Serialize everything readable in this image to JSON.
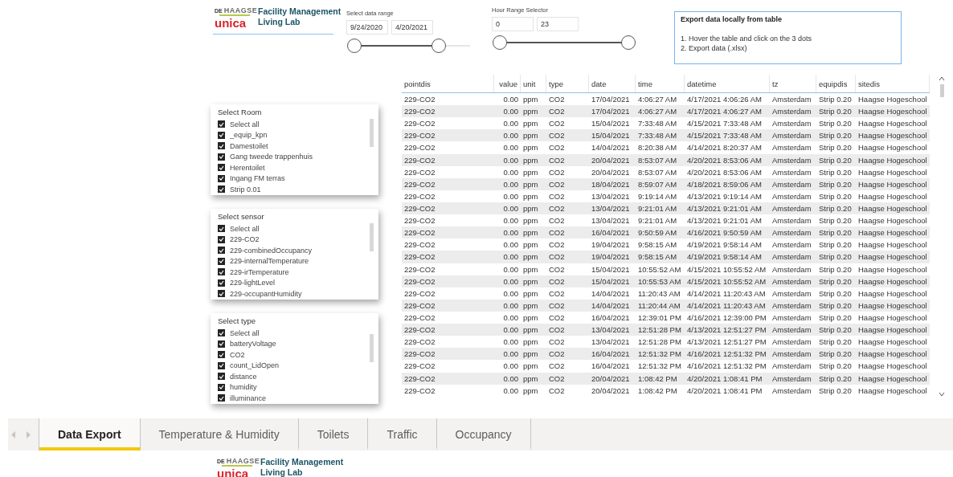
{
  "header": {
    "logo": {
      "prefix": "DE",
      "name": "HAAGSE",
      "brand": "unica"
    },
    "title_lines": [
      "Facility Management",
      "Living Lab"
    ]
  },
  "date_range": {
    "label": "Select data range",
    "start": "9/24/2020",
    "end": "4/20/2021",
    "thumbs": [
      {
        "level": 0
      },
      {
        "level": 0.73
      }
    ]
  },
  "hour_range": {
    "label": "Hour Range Selector",
    "start": "0",
    "end": "23",
    "thumbs": [
      {
        "level": 0
      },
      {
        "level": 1
      }
    ]
  },
  "export_note": {
    "title": "Export data locally from table",
    "steps": [
      "1. Hover the table and click on the 3 dots",
      "2. Export data (.xlsx)"
    ]
  },
  "slicers": [
    {
      "title": "Select Room",
      "items": [
        {
          "label": "Select all",
          "checked": true
        },
        {
          "label": "_equip_kpn",
          "checked": true
        },
        {
          "label": "Damestoilet",
          "checked": true
        },
        {
          "label": "Gang tweede trappenhuis",
          "checked": true
        },
        {
          "label": "Herentoilet",
          "checked": true
        },
        {
          "label": "Ingang FM terras",
          "checked": true
        },
        {
          "label": "Strip 0.01",
          "checked": true
        }
      ]
    },
    {
      "title": "Select sensor",
      "items": [
        {
          "label": "Select all",
          "checked": true
        },
        {
          "label": "229-CO2",
          "checked": true
        },
        {
          "label": "229-combinedOccupancy",
          "checked": true
        },
        {
          "label": "229-internalTemperature",
          "checked": true
        },
        {
          "label": "229-irTemperature",
          "checked": true
        },
        {
          "label": "229-lightLevel",
          "checked": true
        },
        {
          "label": "229-occupantHumidity",
          "checked": true
        }
      ]
    },
    {
      "title": "Select type",
      "items": [
        {
          "label": "Select all",
          "checked": true
        },
        {
          "label": "batteryVoltage",
          "checked": true
        },
        {
          "label": "CO2",
          "checked": true
        },
        {
          "label": "count_LidOpen",
          "checked": true
        },
        {
          "label": "distance",
          "checked": true
        },
        {
          "label": "humidity",
          "checked": true
        },
        {
          "label": "illuminance",
          "checked": true
        }
      ]
    }
  ],
  "table": {
    "columns": [
      {
        "label": "pointdis",
        "kind": "text"
      },
      {
        "label": "value",
        "kind": "number"
      },
      {
        "label": "unit",
        "kind": "text"
      },
      {
        "label": "type",
        "kind": "text"
      },
      {
        "label": "date",
        "kind": "text"
      },
      {
        "label": "time",
        "kind": "text"
      },
      {
        "label": "datetime",
        "kind": "text"
      },
      {
        "label": "tz",
        "kind": "text"
      },
      {
        "label": "equipdis",
        "kind": "text"
      },
      {
        "label": "sitedis",
        "kind": "text"
      }
    ],
    "rows": [
      [
        "229-CO2",
        "0.00",
        "ppm",
        "CO2",
        "17/04/2021",
        "4:06:27 AM",
        "4/17/2021 4:06:26 AM",
        "Amsterdam",
        "Strip 0.20",
        "Haagse Hogeschool"
      ],
      [
        "229-CO2",
        "0.00",
        "ppm",
        "CO2",
        "17/04/2021",
        "4:06:27 AM",
        "4/17/2021 4:06:27 AM",
        "Amsterdam",
        "Strip 0.20",
        "Haagse Hogeschool"
      ],
      [
        "229-CO2",
        "0.00",
        "ppm",
        "CO2",
        "15/04/2021",
        "7:33:48 AM",
        "4/15/2021 7:33:48 AM",
        "Amsterdam",
        "Strip 0.20",
        "Haagse Hogeschool"
      ],
      [
        "229-CO2",
        "0.00",
        "ppm",
        "CO2",
        "15/04/2021",
        "7:33:48 AM",
        "4/15/2021 7:33:48 AM",
        "Amsterdam",
        "Strip 0.20",
        "Haagse Hogeschool"
      ],
      [
        "229-CO2",
        "0.00",
        "ppm",
        "CO2",
        "14/04/2021",
        "8:20:38 AM",
        "4/14/2021 8:20:37 AM",
        "Amsterdam",
        "Strip 0.20",
        "Haagse Hogeschool"
      ],
      [
        "229-CO2",
        "0.00",
        "ppm",
        "CO2",
        "20/04/2021",
        "8:53:07 AM",
        "4/20/2021 8:53:06 AM",
        "Amsterdam",
        "Strip 0.20",
        "Haagse Hogeschool"
      ],
      [
        "229-CO2",
        "0.00",
        "ppm",
        "CO2",
        "20/04/2021",
        "8:53:07 AM",
        "4/20/2021 8:53:06 AM",
        "Amsterdam",
        "Strip 0.20",
        "Haagse Hogeschool"
      ],
      [
        "229-CO2",
        "0.00",
        "ppm",
        "CO2",
        "18/04/2021",
        "8:59:07 AM",
        "4/18/2021 8:59:06 AM",
        "Amsterdam",
        "Strip 0.20",
        "Haagse Hogeschool"
      ],
      [
        "229-CO2",
        "0.00",
        "ppm",
        "CO2",
        "13/04/2021",
        "9:19:14 AM",
        "4/13/2021 9:19:14 AM",
        "Amsterdam",
        "Strip 0.20",
        "Haagse Hogeschool"
      ],
      [
        "229-CO2",
        "0.00",
        "ppm",
        "CO2",
        "13/04/2021",
        "9:21:01 AM",
        "4/13/2021 9:21:01 AM",
        "Amsterdam",
        "Strip 0.20",
        "Haagse Hogeschool"
      ],
      [
        "229-CO2",
        "0.00",
        "ppm",
        "CO2",
        "13/04/2021",
        "9:21:01 AM",
        "4/13/2021 9:21:01 AM",
        "Amsterdam",
        "Strip 0.20",
        "Haagse Hogeschool"
      ],
      [
        "229-CO2",
        "0.00",
        "ppm",
        "CO2",
        "16/04/2021",
        "9:50:59 AM",
        "4/16/2021 9:50:59 AM",
        "Amsterdam",
        "Strip 0.20",
        "Haagse Hogeschool"
      ],
      [
        "229-CO2",
        "0.00",
        "ppm",
        "CO2",
        "19/04/2021",
        "9:58:15 AM",
        "4/19/2021 9:58:14 AM",
        "Amsterdam",
        "Strip 0.20",
        "Haagse Hogeschool"
      ],
      [
        "229-CO2",
        "0.00",
        "ppm",
        "CO2",
        "19/04/2021",
        "9:58:15 AM",
        "4/19/2021 9:58:14 AM",
        "Amsterdam",
        "Strip 0.20",
        "Haagse Hogeschool"
      ],
      [
        "229-CO2",
        "0.00",
        "ppm",
        "CO2",
        "15/04/2021",
        "10:55:52 AM",
        "4/15/2021 10:55:52 AM",
        "Amsterdam",
        "Strip 0.20",
        "Haagse Hogeschool"
      ],
      [
        "229-CO2",
        "0.00",
        "ppm",
        "CO2",
        "15/04/2021",
        "10:55:53 AM",
        "4/15/2021 10:55:52 AM",
        "Amsterdam",
        "Strip 0.20",
        "Haagse Hogeschool"
      ],
      [
        "229-CO2",
        "0.00",
        "ppm",
        "CO2",
        "14/04/2021",
        "11:20:43 AM",
        "4/14/2021 11:20:43 AM",
        "Amsterdam",
        "Strip 0.20",
        "Haagse Hogeschool"
      ],
      [
        "229-CO2",
        "0.00",
        "ppm",
        "CO2",
        "14/04/2021",
        "11:20:44 AM",
        "4/14/2021 11:20:43 AM",
        "Amsterdam",
        "Strip 0.20",
        "Haagse Hogeschool"
      ],
      [
        "229-CO2",
        "0.00",
        "ppm",
        "CO2",
        "16/04/2021",
        "12:39:01 PM",
        "4/16/2021 12:39:00 PM",
        "Amsterdam",
        "Strip 0.20",
        "Haagse Hogeschool"
      ],
      [
        "229-CO2",
        "0.00",
        "ppm",
        "CO2",
        "13/04/2021",
        "12:51:28 PM",
        "4/13/2021 12:51:27 PM",
        "Amsterdam",
        "Strip 0.20",
        "Haagse Hogeschool"
      ],
      [
        "229-CO2",
        "0.00",
        "ppm",
        "CO2",
        "13/04/2021",
        "12:51:28 PM",
        "4/13/2021 12:51:27 PM",
        "Amsterdam",
        "Strip 0.20",
        "Haagse Hogeschool"
      ],
      [
        "229-CO2",
        "0.00",
        "ppm",
        "CO2",
        "16/04/2021",
        "12:51:32 PM",
        "4/16/2021 12:51:32 PM",
        "Amsterdam",
        "Strip 0.20",
        "Haagse Hogeschool"
      ],
      [
        "229-CO2",
        "0.00",
        "ppm",
        "CO2",
        "16/04/2021",
        "12:51:32 PM",
        "4/16/2021 12:51:32 PM",
        "Amsterdam",
        "Strip 0.20",
        "Haagse Hogeschool"
      ],
      [
        "229-CO2",
        "0.00",
        "ppm",
        "CO2",
        "20/04/2021",
        "1:08:42 PM",
        "4/20/2021 1:08:41 PM",
        "Amsterdam",
        "Strip 0.20",
        "Haagse Hogeschool"
      ],
      [
        "229-CO2",
        "0.00",
        "ppm",
        "CO2",
        "20/04/2021",
        "1:08:42 PM",
        "4/20/2021 1:08:41 PM",
        "Amsterdam",
        "Strip 0.20",
        "Haagse Hogeschool"
      ]
    ]
  },
  "page_tabs": [
    {
      "label": "Data Export",
      "selected": true
    },
    {
      "label": "Temperature & Humidity",
      "selected": false
    },
    {
      "label": "Toilets",
      "selected": false
    },
    {
      "label": "Traffic",
      "selected": false
    },
    {
      "label": "Occupancy",
      "selected": false
    }
  ],
  "footer": {
    "logo": {
      "prefix": "DE",
      "name": "HAAGSE",
      "brand": "unica"
    },
    "title_lines": [
      "Facility Management",
      "Living Lab"
    ]
  }
}
